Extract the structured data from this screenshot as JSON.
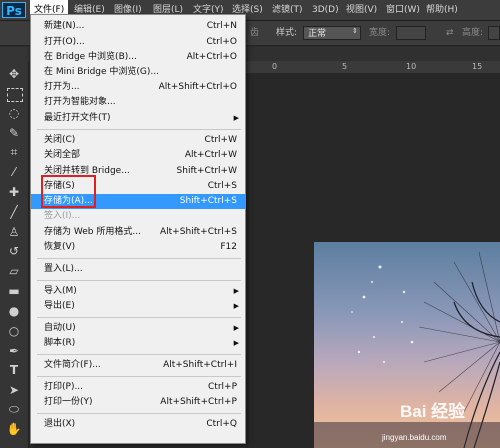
{
  "app": {
    "logo": "Ps"
  },
  "menubar": [
    {
      "label": "文件(F)"
    },
    {
      "label": "编辑(E)"
    },
    {
      "label": "图像(I)"
    },
    {
      "label": "图层(L)"
    },
    {
      "label": "文字(Y)"
    },
    {
      "label": "选择(S)"
    },
    {
      "label": "滤镜(T)"
    },
    {
      "label": "3D(D)"
    },
    {
      "label": "视图(V)"
    },
    {
      "label": "窗口(W)"
    },
    {
      "label": "帮助(H)"
    }
  ],
  "options_bar": {
    "partial_label": "齿",
    "style_label": "样式:",
    "style_value": "正常",
    "width_label": "宽度:",
    "height_label": "高度:"
  },
  "ruler": {
    "ticks": [
      "0",
      "5",
      "10",
      "15"
    ]
  },
  "file_menu": {
    "items": [
      {
        "label": "新建(N)...",
        "shortcut": "Ctrl+N"
      },
      {
        "label": "打开(O)...",
        "shortcut": "Ctrl+O"
      },
      {
        "label": "在 Bridge 中浏览(B)...",
        "shortcut": "Alt+Ctrl+O"
      },
      {
        "label": "在 Mini Bridge 中浏览(G)...",
        "shortcut": ""
      },
      {
        "label": "打开为...",
        "shortcut": "Alt+Shift+Ctrl+O"
      },
      {
        "label": "打开为智能对象...",
        "shortcut": ""
      },
      {
        "label": "最近打开文件(T)",
        "shortcut": ""
      },
      {
        "label": "关闭(C)",
        "shortcut": "Ctrl+W"
      },
      {
        "label": "关闭全部",
        "shortcut": "Alt+Ctrl+W"
      },
      {
        "label": "关闭并转到 Bridge...",
        "shortcut": "Shift+Ctrl+W"
      },
      {
        "label": "存储(S)",
        "shortcut": "Ctrl+S"
      },
      {
        "label": "存储为(A)...",
        "shortcut": "Shift+Ctrl+S"
      },
      {
        "label": "签入(I)...",
        "shortcut": ""
      },
      {
        "label": "存储为 Web 所用格式...",
        "shortcut": "Alt+Shift+Ctrl+S"
      },
      {
        "label": "恢复(V)",
        "shortcut": "F12"
      },
      {
        "label": "置入(L)...",
        "shortcut": ""
      },
      {
        "label": "导入(M)",
        "shortcut": ""
      },
      {
        "label": "导出(E)",
        "shortcut": ""
      },
      {
        "label": "自动(U)",
        "shortcut": ""
      },
      {
        "label": "脚本(R)",
        "shortcut": ""
      },
      {
        "label": "文件简介(F)...",
        "shortcut": "Alt+Shift+Ctrl+I"
      },
      {
        "label": "打印(P)...",
        "shortcut": "Ctrl+P"
      },
      {
        "label": "打印一份(Y)",
        "shortcut": "Alt+Shift+Ctrl+P"
      },
      {
        "label": "退出(X)",
        "shortcut": "Ctrl+Q"
      }
    ],
    "highlight_color": "#3399ff"
  },
  "watermark": {
    "logo": "Bai 经验",
    "url": "jingyan.baidu.com"
  }
}
